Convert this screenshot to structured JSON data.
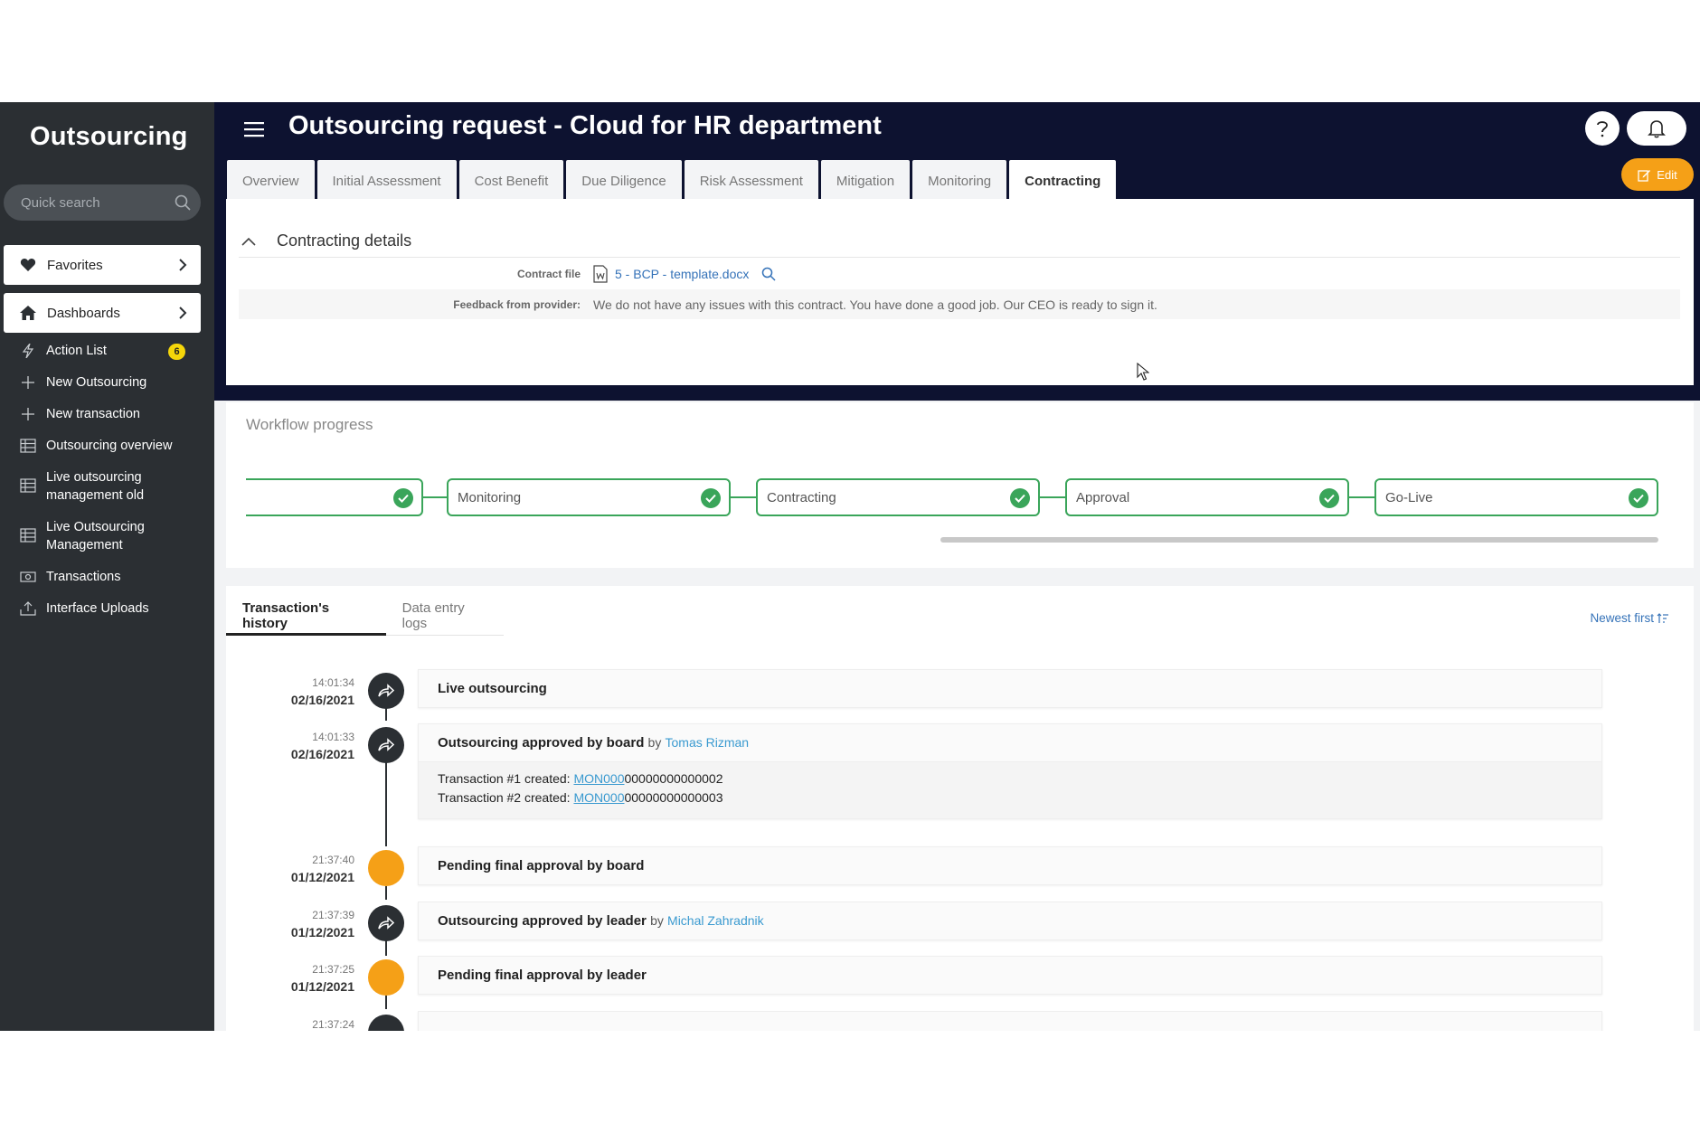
{
  "sidebar": {
    "brand": "Outsourcing",
    "search_placeholder": "Quick search",
    "favorites_label": "Favorites",
    "dashboards_label": "Dashboards",
    "items": [
      {
        "label": "Action List",
        "icon": "bolt-icon",
        "badge": "6"
      },
      {
        "label": "New Outsourcing",
        "icon": "plus-icon"
      },
      {
        "label": "New transaction",
        "icon": "plus-icon"
      },
      {
        "label": "Outsourcing overview",
        "icon": "table-icon"
      },
      {
        "label": "Live outsourcing management old",
        "icon": "table-icon"
      },
      {
        "label": "Live Outsourcing Management",
        "icon": "table-icon"
      },
      {
        "label": "Transactions",
        "icon": "money-icon"
      },
      {
        "label": "Interface Uploads",
        "icon": "upload-icon"
      }
    ]
  },
  "header": {
    "title": "Outsourcing request - Cloud for HR department",
    "edit_label": "Edit",
    "tabs": [
      "Overview",
      "Initial Assessment",
      "Cost Benefit",
      "Due Diligence",
      "Risk Assessment",
      "Mitigation",
      "Monitoring",
      "Contracting"
    ],
    "active_tab": "Contracting"
  },
  "details": {
    "title": "Contracting details",
    "contract_file_label": "Contract file",
    "contract_file_name": "5 - BCP - template.docx",
    "feedback_label": "Feedback from provider:",
    "feedback_value": "We do not have any issues with this contract. You have done a good job. Our CEO is ready to sign it."
  },
  "workflow": {
    "title": "Workflow progress",
    "steps": [
      "",
      "Monitoring",
      "Contracting",
      "Approval",
      "Go-Live"
    ],
    "status_color": "#3aa55a"
  },
  "history": {
    "tabs": [
      "Transaction's history",
      "Data entry logs"
    ],
    "sort_label": "Newest first",
    "entries": [
      {
        "time": "14:01:34",
        "date": "02/16/2021",
        "title": "Live outsourcing",
        "type": "dark"
      },
      {
        "time": "14:01:33",
        "date": "02/16/2021",
        "title": "Outsourcing approved by board",
        "by": "by",
        "user": "Tomas Rizman",
        "type": "dark",
        "transactions": [
          {
            "prefix": "Transaction #1 created: ",
            "link": "MON000",
            "rest": "00000000000002"
          },
          {
            "prefix": "Transaction #2 created: ",
            "link": "MON000",
            "rest": "00000000000003"
          }
        ]
      },
      {
        "time": "21:37:40",
        "date": "01/12/2021",
        "title": "Pending final approval by board",
        "type": "orange"
      },
      {
        "time": "21:37:39",
        "date": "01/12/2021",
        "title": "Outsourcing approved by leader",
        "by": "by",
        "user": "Michal Zahradnik",
        "type": "dark"
      },
      {
        "time": "21:37:25",
        "date": "01/12/2021",
        "title": "Pending final approval by leader",
        "type": "orange"
      },
      {
        "time": "21:37:24",
        "date": "",
        "title": "",
        "type": "dark"
      }
    ]
  }
}
